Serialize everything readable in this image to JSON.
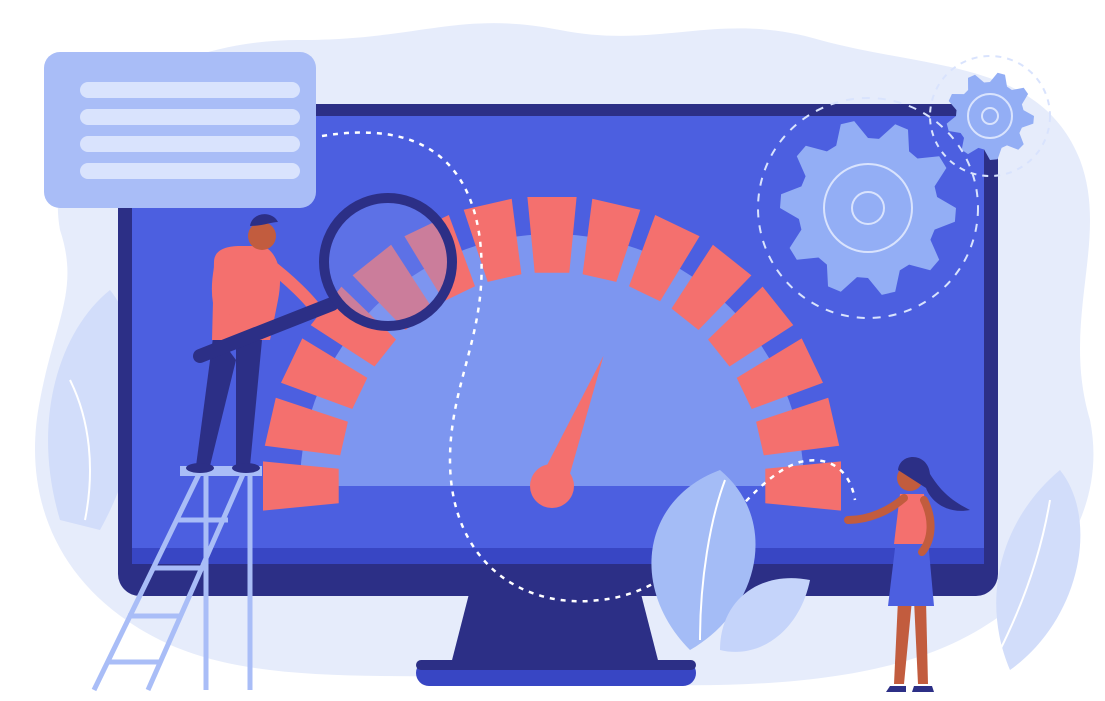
{
  "illustration": {
    "subject": "speedometer-on-monitor",
    "icons": [
      "magnifier-icon",
      "gear-icon",
      "speedometer-icon",
      "leaf-icon",
      "ladder-icon"
    ],
    "gauge_segment_count": 15,
    "needle_level": 0.62
  },
  "colors": {
    "background": "#ffffff",
    "blob": "#e6ecfb",
    "monitor_frame": "#2c2f86",
    "screen": "#4c5fe0",
    "screen_dark": "#3846c4",
    "dial": "#7d96f0",
    "gauge_segment": "#f4706e",
    "needle": "#f4706e",
    "card": "#a9bdf7",
    "card_lines": "#d9e3fd",
    "gear": "#93aef5",
    "ladder": "#a9bdf7",
    "leaf": "#a4bcf6",
    "shirt": "#f4706e",
    "pants": "#2c2f86",
    "skin": "#c25c3e",
    "hair": "#2c2f86",
    "skirt": "#4c5fe0"
  }
}
